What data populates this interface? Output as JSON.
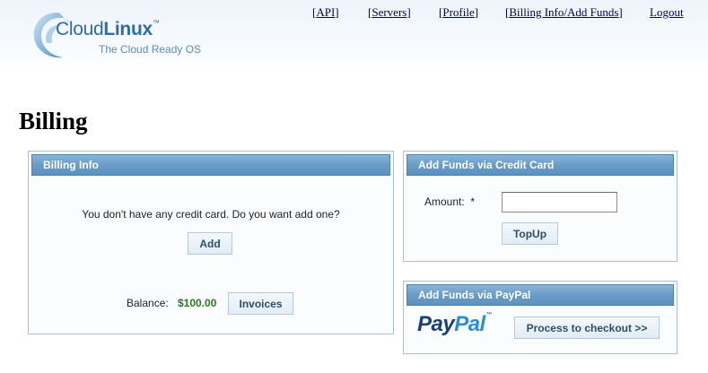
{
  "brand": {
    "name_light": "Cloud",
    "name_bold": "Linux",
    "trademark": "™",
    "tagline": "The Cloud Ready OS",
    "logo_icon": "cloud-swirl-logo-icon"
  },
  "nav": [
    {
      "label": "API",
      "bracketed": true
    },
    {
      "label": "Servers",
      "bracketed": true
    },
    {
      "label": "Profile",
      "bracketed": true
    },
    {
      "label": "Billing Info/Add Funds",
      "bracketed": true
    },
    {
      "label": "Logout",
      "bracketed": false
    }
  ],
  "page": {
    "title": "Billing"
  },
  "billing_info": {
    "header": "Billing Info",
    "message": "You don't have any credit card. Do you want add one?",
    "add_label": "Add",
    "balance_label": "Balance:",
    "balance_value": "$100.00",
    "invoices_label": "Invoices"
  },
  "credit_card": {
    "header": "Add Funds via Credit Card",
    "amount_label": "Amount:",
    "required_marker": "*",
    "amount_value": "",
    "topup_label": "TopUp"
  },
  "paypal": {
    "header": "Add Funds via PayPal",
    "logo_part1": "Pay",
    "logo_part2": "Pal",
    "logo_tm": "™",
    "checkout_label": "Process to checkout >>"
  },
  "colors": {
    "panel_header": "#6a9cc7",
    "nav_link": "#00006e",
    "balance": "#2a7a1e",
    "paypal_dark": "#1a3f7a",
    "paypal_light": "#2b8dd6"
  }
}
